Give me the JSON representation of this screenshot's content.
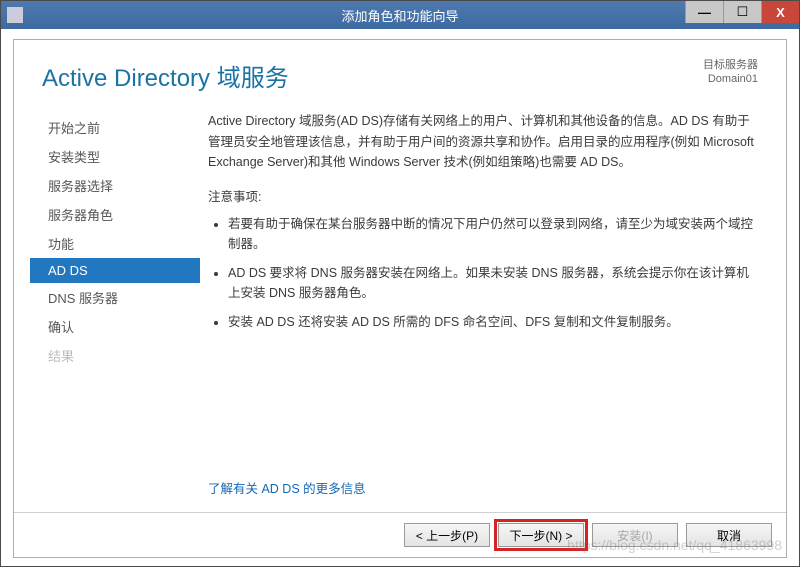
{
  "window": {
    "title": "添加角色和功能向导"
  },
  "header": {
    "page_title": "Active Directory 域服务",
    "target_label": "目标服务器",
    "target_value": "Domain01"
  },
  "sidebar": {
    "items": [
      {
        "label": "开始之前",
        "state": "normal"
      },
      {
        "label": "安装类型",
        "state": "normal"
      },
      {
        "label": "服务器选择",
        "state": "normal"
      },
      {
        "label": "服务器角色",
        "state": "normal"
      },
      {
        "label": "功能",
        "state": "normal"
      },
      {
        "label": "AD DS",
        "state": "active"
      },
      {
        "label": "DNS 服务器",
        "state": "normal"
      },
      {
        "label": "确认",
        "state": "normal"
      },
      {
        "label": "结果",
        "state": "disabled"
      }
    ]
  },
  "main": {
    "description": "Active Directory 域服务(AD DS)存储有关网络上的用户、计算机和其他设备的信息。AD DS 有助于管理员安全地管理该信息，并有助于用户间的资源共享和协作。启用目录的应用程序(例如 Microsoft Exchange Server)和其他 Windows Server 技术(例如组策略)也需要 AD DS。",
    "notes_label": "注意事项:",
    "bullets": [
      "若要有助于确保在某台服务器中断的情况下用户仍然可以登录到网络，请至少为域安装两个域控制器。",
      "AD DS 要求将 DNS 服务器安装在网络上。如果未安装 DNS 服务器，系统会提示你在该计算机上安装 DNS 服务器角色。",
      "安装 AD DS 还将安装 AD DS 所需的 DFS 命名空间、DFS 复制和文件复制服务。"
    ],
    "learn_more": "了解有关 AD DS 的更多信息"
  },
  "footer": {
    "prev": "< 上一步(P)",
    "next": "下一步(N) >",
    "install": "安装(I)",
    "cancel": "取消"
  },
  "watermark": "https://blog.csdn.net/qq_41863998"
}
